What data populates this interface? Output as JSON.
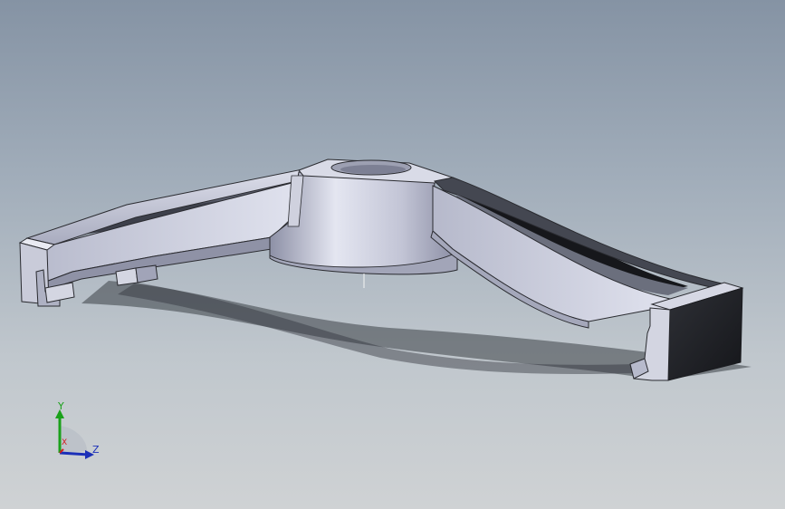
{
  "viewport": {
    "background_top": "#8593a4",
    "background_bottom": "#cfd2d4",
    "model_color": "#b9bccc",
    "shadow_color": "#3a3f46"
  },
  "triad": {
    "y_label": "Y",
    "x_label": "X",
    "z_label": "Z",
    "y_color": "#1aa11a",
    "x_color": "#d02020",
    "z_color": "#1c30b8"
  }
}
